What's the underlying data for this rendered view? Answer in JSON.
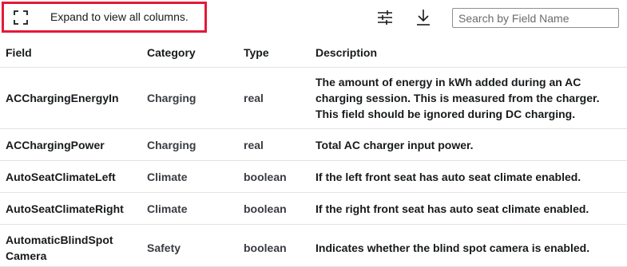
{
  "toolbar": {
    "expand_label": "Expand to view all columns.",
    "expand_icon": "expand-icon",
    "filter_icon": "sliders-icon",
    "download_icon": "download-icon",
    "search_placeholder": "Search by Field Name",
    "highlight_color": "#e31937"
  },
  "table": {
    "headers": [
      "Field",
      "Category",
      "Type",
      "Description"
    ],
    "rows": [
      {
        "field": "ACChargingEnergyIn",
        "category": "Charging",
        "type": "real",
        "description": "The amount of energy in kWh added during an AC charging session. This is measured from the charger. This field should be ignored during DC charging."
      },
      {
        "field": "ACChargingPower",
        "category": "Charging",
        "type": "real",
        "description": "Total AC charger input power."
      },
      {
        "field": "AutoSeatClimateLeft",
        "category": "Climate",
        "type": "boolean",
        "description": "If the left front seat has auto seat climate enabled."
      },
      {
        "field": "AutoSeatClimateRight",
        "category": "Climate",
        "type": "boolean",
        "description": "If the right front seat has auto seat climate enabled."
      },
      {
        "field": "AutomaticBlindSpot Camera",
        "category": "Safety",
        "type": "boolean",
        "description": "Indicates whether the blind spot camera is enabled."
      }
    ]
  }
}
